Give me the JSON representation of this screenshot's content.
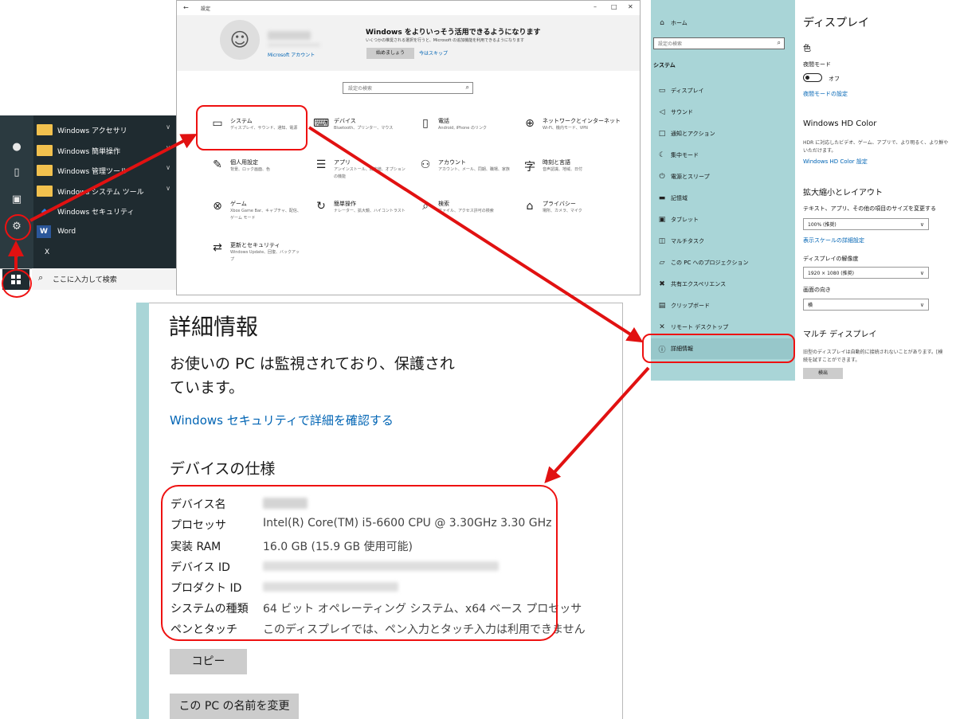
{
  "start_menu": {
    "items": [
      {
        "label": "Windows アクセサリ",
        "icon": "folder-icon",
        "expandable": true
      },
      {
        "label": "Windows 簡単操作",
        "icon": "folder-icon",
        "expandable": true
      },
      {
        "label": "Windows 管理ツール",
        "icon": "folder-icon",
        "expandable": true
      },
      {
        "label": "Windows システム ツール",
        "icon": "folder-icon",
        "expandable": true
      },
      {
        "label": "Windows セキュリティ",
        "icon": "shield-icon",
        "expandable": false
      },
      {
        "label": "Word",
        "icon": "word-icon",
        "expandable": false
      },
      {
        "label": "X",
        "icon": "",
        "expandable": false
      }
    ],
    "search_placeholder": "ここに入力して検索"
  },
  "settings_home": {
    "title": "設定",
    "account_link": "Microsoft アカウント",
    "promo_title": "Windows をよりいっそう活用できるようになります",
    "promo_desc": "いくつかの推奨される選択を行うと、Microsoft の追加機能を利用できるようになります",
    "promo_start": "始めましょう",
    "promo_skip": "今はスキップ",
    "search_placeholder": "設定の検索",
    "categories": [
      {
        "title": "システム",
        "desc": "ディスプレイ、サウンド、通知、電源",
        "icon": "laptop-icon"
      },
      {
        "title": "デバイス",
        "desc": "Bluetooth、プリンター、マウス",
        "icon": "keyboard-icon"
      },
      {
        "title": "電話",
        "desc": "Android, iPhone のリンク",
        "icon": "phone-icon"
      },
      {
        "title": "ネットワークとインターネット",
        "desc": "Wi-Fi、機内モード、VPN",
        "icon": "globe-icon"
      },
      {
        "title": "個人用設定",
        "desc": "背景、ロック画面、色",
        "icon": "paint-icon"
      },
      {
        "title": "アプリ",
        "desc": "アンインストール、既定値、オプションの機能",
        "icon": "apps-icon"
      },
      {
        "title": "アカウント",
        "desc": "アカウント、メール、同期、職場、家族",
        "icon": "person-icon"
      },
      {
        "title": "時刻と言語",
        "desc": "音声認識、地域、日付",
        "icon": "time-language-icon"
      },
      {
        "title": "ゲーム",
        "desc": "Xbox Game Bar、キャプチャ、配信、ゲーム モード",
        "icon": "xbox-icon"
      },
      {
        "title": "簡単操作",
        "desc": "ナレーター、拡大鏡、ハイコントラスト",
        "icon": "ease-icon"
      },
      {
        "title": "検索",
        "desc": "ファイル、アクセス許可の検索",
        "icon": "search-icon"
      },
      {
        "title": "プライバシー",
        "desc": "場所、カメラ、マイク",
        "icon": "lock-icon"
      },
      {
        "title": "更新とセキュリティ",
        "desc": "Windows Update、回復、バックアップ",
        "icon": "sync-icon"
      }
    ]
  },
  "settings_display": {
    "nav_home": "ホーム",
    "nav_search": "設定の検索",
    "nav_section": "システム",
    "nav_items": [
      {
        "label": "ディスプレイ",
        "icon": "monitor-icon"
      },
      {
        "label": "サウンド",
        "icon": "speaker-icon"
      },
      {
        "label": "通知とアクション",
        "icon": "notification-icon"
      },
      {
        "label": "集中モード",
        "icon": "moon-icon"
      },
      {
        "label": "電源とスリープ",
        "icon": "power-icon"
      },
      {
        "label": "記憶域",
        "icon": "storage-icon"
      },
      {
        "label": "タブレット",
        "icon": "tablet-icon"
      },
      {
        "label": "マルチタスク",
        "icon": "multitask-icon"
      },
      {
        "label": "この PC へのプロジェクション",
        "icon": "projection-icon"
      },
      {
        "label": "共有エクスペリエンス",
        "icon": "share-icon"
      },
      {
        "label": "クリップボード",
        "icon": "clipboard-icon"
      },
      {
        "label": "リモート デスクトップ",
        "icon": "remote-icon"
      },
      {
        "label": "詳細情報",
        "icon": "info-icon"
      }
    ],
    "page_title": "ディスプレイ",
    "color_heading": "色",
    "night_light_label": "夜間モード",
    "night_light_state": "オフ",
    "night_light_link": "夜間モードの設定",
    "hdr_heading": "Windows HD Color",
    "hdr_desc": "HDR に対応したビデオ、ゲーム、アプリで、より明るく、より鮮や",
    "hdr_desc2": "いただけます。",
    "hdr_link": "Windows HD Color 設定",
    "scale_heading": "拡大縮小とレイアウト",
    "scale_label": "テキスト、アプリ、その他の項目のサイズを変更する",
    "scale_value": "100% (推奨)",
    "scale_link": "表示スケールの詳細設定",
    "resolution_label": "ディスプレイの解像度",
    "resolution_value": "1920 × 1080 (推奨)",
    "orientation_label": "画面の向き",
    "orientation_value": "横",
    "multi_heading": "マルチ ディスプレイ",
    "multi_desc": "旧型のディスプレイは自動的に接続されないことがあります。[検",
    "multi_desc2": "続を試すことができます。",
    "detect_button": "検出"
  },
  "about": {
    "title": "詳細情報",
    "status_line1": "お使いの PC は監視されており、保護され",
    "status_line2": "ています。",
    "security_link": "Windows セキュリティで詳細を確認する",
    "spec_heading": "デバイスの仕様",
    "specs": [
      {
        "label": "デバイス名",
        "value": ""
      },
      {
        "label": "プロセッサ",
        "value": "Intel(R) Core(TM) i5-6600 CPU @ 3.30GHz   3.30 GHz"
      },
      {
        "label": "実装 RAM",
        "value": "16.0 GB (15.9 GB 使用可能)"
      },
      {
        "label": "デバイス ID",
        "value": ""
      },
      {
        "label": "プロダクト ID",
        "value": ""
      },
      {
        "label": "システムの種類",
        "value": "64 ビット オペレーティング システム、x64 ベース プロセッサ"
      },
      {
        "label": "ペンとタッチ",
        "value": "このディスプレイでは、ペン入力とタッチ入力は利用できません"
      }
    ],
    "copy_button": "コピー",
    "rename_button": "この PC の名前を変更"
  },
  "colors": {
    "annotation_red": "#e11111",
    "accent_teal": "#a9d5d7",
    "link_blue": "#0064b4"
  }
}
